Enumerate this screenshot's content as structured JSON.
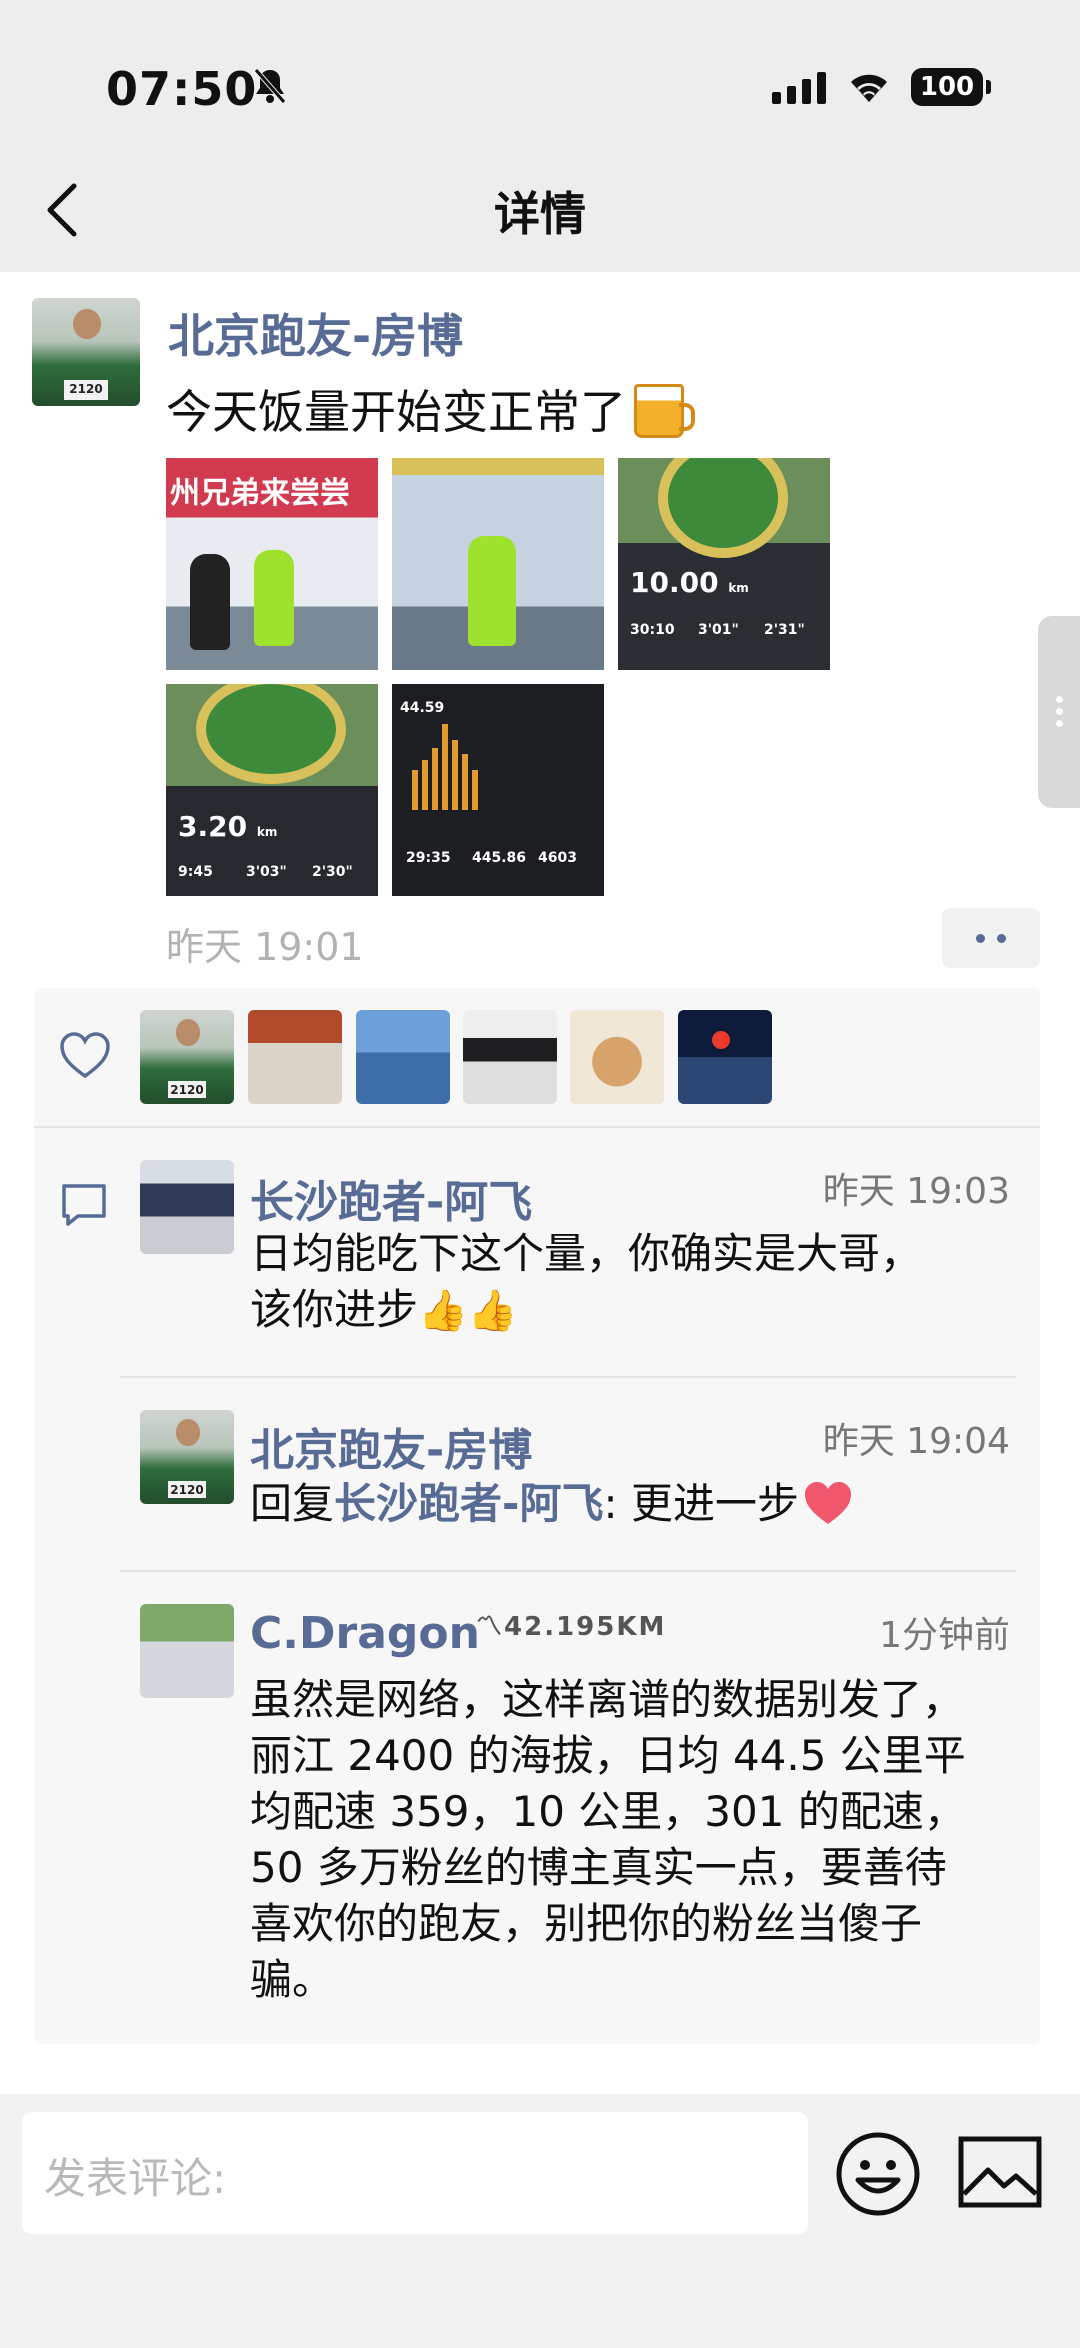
{
  "status_bar": {
    "time": "07:50",
    "battery": "100"
  },
  "nav": {
    "title": "详情"
  },
  "post": {
    "author": "北京跑友-房博",
    "text": "今天饭量开始变正常了",
    "time": "昨天 19:01",
    "images": [
      {
        "banner": "州兄弟来尝尝"
      },
      {
        "banner": ""
      },
      {
        "distance": "10.00",
        "unit": "km",
        "stats": [
          "30:10",
          "3'01\"",
          "2'31\""
        ]
      },
      {
        "distance": "3.20",
        "unit": "km",
        "stats": [
          "9:45",
          "3'03\"",
          "2'30\""
        ]
      },
      {
        "distance": "44.59",
        "stats": [
          "29:35",
          "445.86",
          "4603"
        ]
      }
    ]
  },
  "comments": [
    {
      "author": "长沙跑者-阿飞",
      "time": "昨天 19:03",
      "lines": [
        "日均能吃下这个量，你确实是大哥，",
        "该你进步"
      ]
    },
    {
      "author": "北京跑友-房博",
      "time": "昨天 19:04",
      "reply_prefix": "回复",
      "reply_to": "长沙跑者-阿飞",
      "reply_text": ": 更进一步"
    },
    {
      "author": "C.Dragon",
      "badge": "42.195KM",
      "time": "1分钟前",
      "lines": [
        "虽然是网络，这样离谱的数据别发了，",
        "丽江 2400 的海拔，日均 44.5 公里平",
        "均配速 359，10 公里，301 的配速，",
        "50 多万粉丝的博主真实一点，要善待",
        "喜欢你的跑友，别把你的粉丝当傻子",
        "骗。"
      ]
    }
  ],
  "composer": {
    "placeholder": "发表评论:"
  },
  "colors": {
    "link": "#576b95",
    "background": "#ededed",
    "comment_bg": "#f7f7f7"
  }
}
